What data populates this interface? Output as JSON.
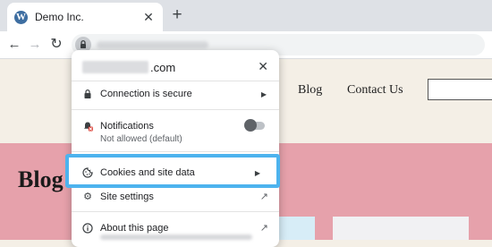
{
  "browser": {
    "tab": {
      "title": "Demo Inc.",
      "favicon": "wordpress-icon",
      "close_icon": "close-icon"
    },
    "new_tab_icon": "plus-icon",
    "toolbar": {
      "back_icon": "arrow-left-icon",
      "forward_icon": "arrow-right-icon",
      "reload_icon": "reload-icon",
      "site_info_icon": "lock-icon"
    }
  },
  "website": {
    "nav": {
      "blog": "Blog",
      "contact": "Contact Us"
    },
    "heading": "Blog",
    "colors": {
      "header_bg": "#f4efe6",
      "band_bg": "#e6a1ab"
    }
  },
  "popup": {
    "domain_suffix": ".com",
    "rows": {
      "connection": {
        "label": "Connection is secure",
        "icon": "lock-icon"
      },
      "notifications": {
        "label": "Notifications",
        "status": "Not allowed (default)",
        "icon": "bell-blocked-icon",
        "enabled": false
      },
      "cookies": {
        "label": "Cookies and site data",
        "icon": "cookie-icon",
        "highlighted": true
      },
      "settings": {
        "label": "Site settings",
        "icon": "gear-icon"
      },
      "about": {
        "label": "About this page",
        "icon": "info-icon"
      }
    },
    "highlight_color": "#4db3ee"
  }
}
